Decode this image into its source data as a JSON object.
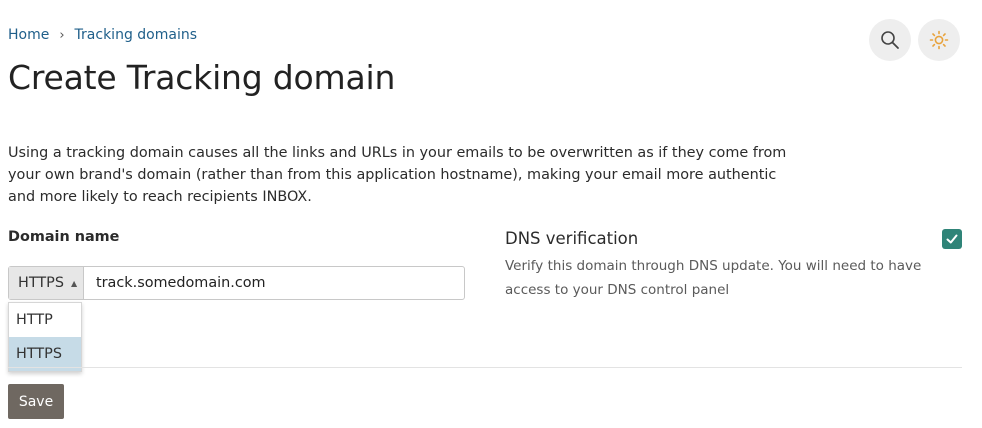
{
  "breadcrumb": {
    "home": "Home",
    "separator": "›",
    "current": "Tracking domains"
  },
  "page": {
    "title": "Create Tracking domain"
  },
  "header_icons": [
    "search-icon",
    "sun-icon"
  ],
  "intro": {
    "text": "Using a tracking domain causes all the links and URLs in your emails to be overwritten as if they come from your own brand's domain (rather than from this application hostname), making your email more authentic and more likely to reach recipients INBOX."
  },
  "domain": {
    "label": "Domain name",
    "protocol_selected": "HTTPS",
    "value": "track.somedomain.com",
    "options": [
      "HTTP",
      "HTTPS"
    ]
  },
  "dns": {
    "title": "DNS verification",
    "description": "Verify this domain through DNS update. You will need to have access to your DNS control panel",
    "checked": true
  },
  "actions": {
    "save_label": "Save"
  },
  "colors": {
    "accent": "#2f8478",
    "link": "#1f5f8a",
    "save_button": "#6f6861",
    "dropdown_selected": "#c6dbe7"
  }
}
